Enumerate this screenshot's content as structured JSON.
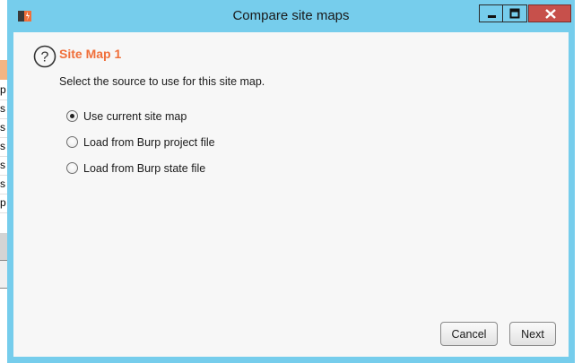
{
  "window": {
    "title": "Compare site maps",
    "app_icon": "burp-icon",
    "controls": [
      "minimize-icon",
      "maximize-icon",
      "close-icon"
    ]
  },
  "dialog": {
    "help_icon": "question-icon",
    "heading": "Site Map 1",
    "instruction": "Select the source to use for this site map.",
    "options": [
      {
        "label": "Use current site map",
        "selected": true
      },
      {
        "label": "Load from Burp project file",
        "selected": false
      },
      {
        "label": "Load from Burp state file",
        "selected": false
      }
    ],
    "buttons": {
      "cancel": "Cancel",
      "next": "Next"
    }
  },
  "background": {
    "letters": [
      "p",
      "s",
      "s",
      "s",
      "s",
      "s",
      "p"
    ]
  },
  "colors": {
    "frame": "#76cdec",
    "heading": "#f06f3a",
    "close_button": "#c7504b",
    "client": "#f7f7f7"
  }
}
